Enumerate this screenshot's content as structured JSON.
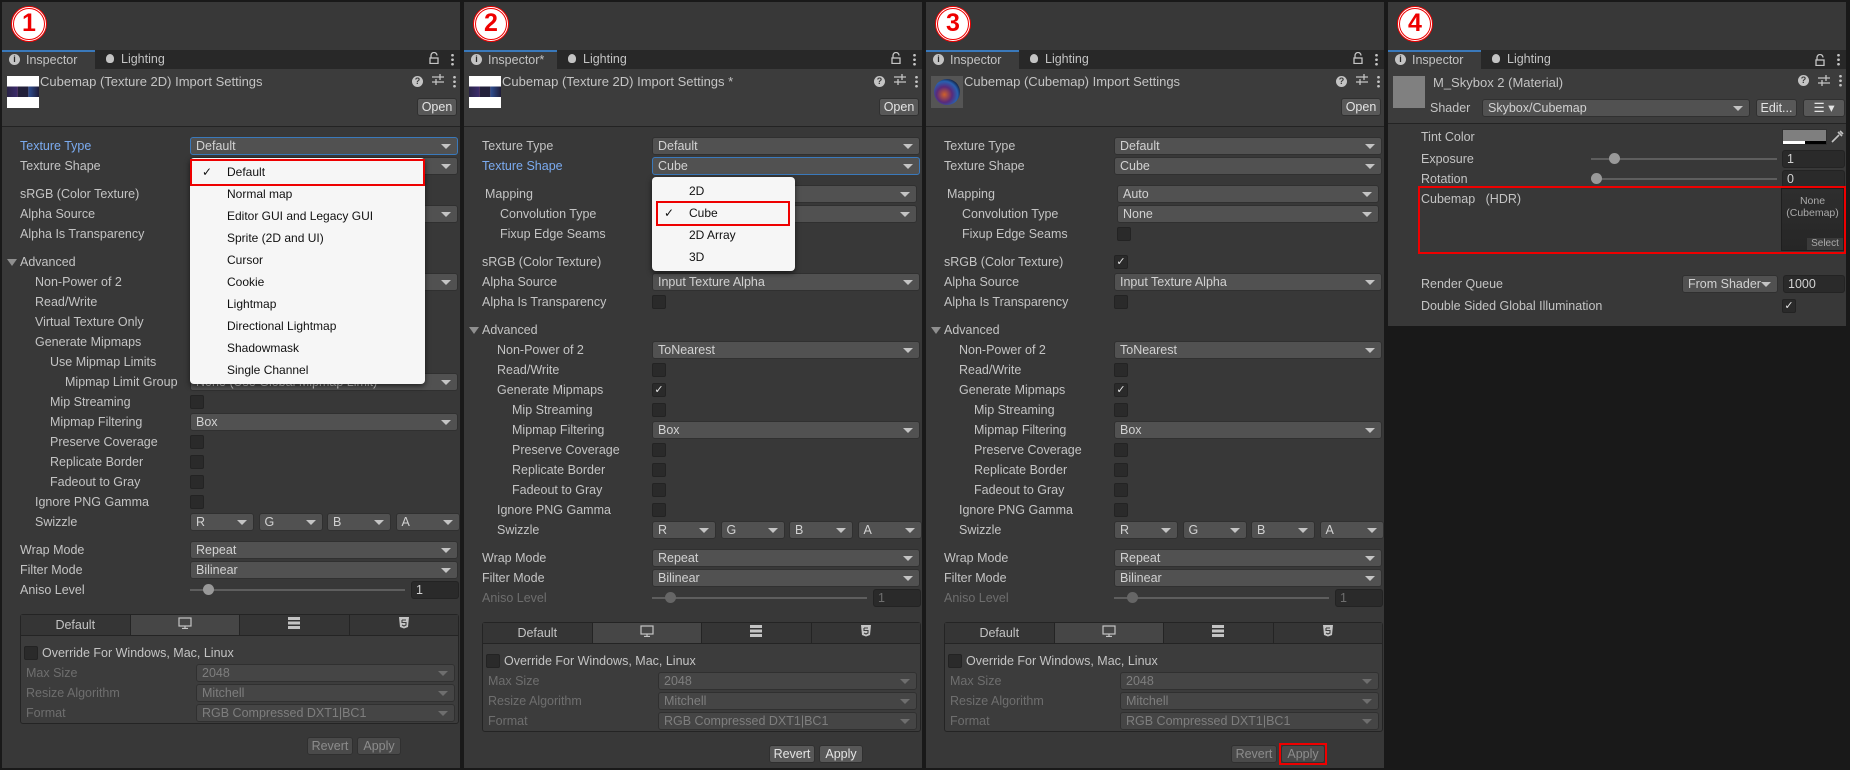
{
  "colors": {
    "accent": "#3a79bb",
    "highlight": "#e00000",
    "panel_bg": "#383838"
  },
  "panels": [
    {
      "badge": "1",
      "tabs": {
        "inspector": "Inspector",
        "lighting": "Lighting"
      },
      "title": "Cubemap (Texture 2D) Import Settings",
      "thumb": "cross",
      "open_label": "Open",
      "sections": [
        [
          {
            "label": "Texture Type",
            "type": "dropdown",
            "value": "Default",
            "focus": true
          },
          {
            "label": "Texture Shape",
            "type": "dropdown"
          }
        ],
        [
          {
            "label": "sRGB (Color Texture)",
            "type": "checkbox"
          },
          {
            "label": "Alpha Source",
            "type": "dropdown"
          },
          {
            "label": "Alpha Is Transparency",
            "type": "checkbox"
          }
        ],
        [
          {
            "label": "Advanced",
            "type": "foldout"
          },
          {
            "label": "Non-Power of 2",
            "indent": 1,
            "type": "dropdown"
          },
          {
            "label": "Read/Write",
            "indent": 1,
            "type": "checkbox"
          },
          {
            "label": "Virtual Texture Only",
            "indent": 1,
            "type": "checkbox"
          },
          {
            "label": "Generate Mipmaps",
            "indent": 1,
            "type": "checkbox"
          },
          {
            "label": "Use Mipmap Limits",
            "indent": 2,
            "type": "checkbox"
          },
          {
            "label": "Mipmap Limit Group",
            "indent": 3,
            "type": "dropdown",
            "value": "None (Use Global Mipmap Limit)"
          },
          {
            "label": "Mip Streaming",
            "indent": 2,
            "type": "checkbox"
          },
          {
            "label": "Mipmap Filtering",
            "indent": 2,
            "type": "dropdown",
            "value": "Box"
          },
          {
            "label": "Preserve Coverage",
            "indent": 2,
            "type": "checkbox"
          },
          {
            "label": "Replicate Border",
            "indent": 2,
            "type": "checkbox"
          },
          {
            "label": "Fadeout to Gray",
            "indent": 2,
            "type": "checkbox"
          },
          {
            "label": "Ignore PNG Gamma",
            "indent": 1,
            "type": "checkbox"
          },
          {
            "label": "Swizzle",
            "indent": 1,
            "type": "swizzle",
            "values": [
              "R",
              "G",
              "B",
              "A"
            ]
          }
        ],
        [
          {
            "label": "Wrap Mode",
            "type": "dropdown",
            "value": "Repeat"
          },
          {
            "label": "Filter Mode",
            "type": "dropdown",
            "value": "Bilinear"
          },
          {
            "label": "Aniso Level",
            "type": "slider",
            "value": 1
          }
        ]
      ],
      "platform": {
        "tabs": [
          "Default",
          "monitor-icon",
          "server-icon",
          "html5-icon"
        ],
        "selected": 1,
        "override": "Override For Windows, Mac, Linux",
        "rows": [
          {
            "label": "Max Size",
            "value": "2048"
          },
          {
            "label": "Resize Algorithm",
            "value": "Mitchell"
          },
          {
            "label": "Format",
            "value": "RGB Compressed DXT1|BC1"
          }
        ]
      },
      "revert": "Revert",
      "apply": "Apply",
      "buttons_enabled": false,
      "apply_highlight": false,
      "popup": {
        "items": [
          "Default",
          "Normal map",
          "Editor GUI and Legacy GUI",
          "Sprite (2D and UI)",
          "Cursor",
          "Cookie",
          "Lightmap",
          "Directional Lightmap",
          "Shadowmask",
          "Single Channel"
        ],
        "selected": 0
      }
    },
    {
      "badge": "2",
      "tabs": {
        "inspector": "Inspector*",
        "lighting": "Lighting"
      },
      "title": "Cubemap (Texture 2D) Import Settings *",
      "thumb": "cross",
      "open_label": "Open",
      "sections": [
        [
          {
            "label": "Texture Type",
            "type": "dropdown",
            "value": "Default"
          },
          {
            "label": "Texture Shape",
            "type": "dropdown",
            "value": "Cube",
            "focus": true
          }
        ],
        [
          {
            "label": "Mapping",
            "type": "dropdown",
            "inset": true
          },
          {
            "label": "Convolution Type",
            "indent": 1,
            "type": "dropdown",
            "inset": true
          },
          {
            "label": "Fixup Edge Seams",
            "indent": 1,
            "type": "checkbox",
            "inset": true
          }
        ],
        [
          {
            "label": "sRGB (Color Texture)",
            "type": "checkbox"
          },
          {
            "label": "Alpha Source",
            "type": "dropdown",
            "value": "Input Texture Alpha"
          },
          {
            "label": "Alpha Is Transparency",
            "type": "checkbox"
          }
        ],
        [
          {
            "label": "Advanced",
            "type": "foldout"
          },
          {
            "label": "Non-Power of 2",
            "indent": 1,
            "type": "dropdown",
            "value": "ToNearest"
          },
          {
            "label": "Read/Write",
            "indent": 1,
            "type": "checkbox"
          },
          {
            "label": "Generate Mipmaps",
            "indent": 1,
            "type": "checkbox",
            "checked": true
          },
          {
            "label": "Mip Streaming",
            "indent": 2,
            "type": "checkbox"
          },
          {
            "label": "Mipmap Filtering",
            "indent": 2,
            "type": "dropdown",
            "value": "Box"
          },
          {
            "label": "Preserve Coverage",
            "indent": 2,
            "type": "checkbox"
          },
          {
            "label": "Replicate Border",
            "indent": 2,
            "type": "checkbox"
          },
          {
            "label": "Fadeout to Gray",
            "indent": 2,
            "type": "checkbox"
          },
          {
            "label": "Ignore PNG Gamma",
            "indent": 1,
            "type": "checkbox"
          },
          {
            "label": "Swizzle",
            "indent": 1,
            "type": "swizzle",
            "values": [
              "R",
              "G",
              "B",
              "A"
            ]
          }
        ],
        [
          {
            "label": "Wrap Mode",
            "type": "dropdown",
            "value": "Repeat"
          },
          {
            "label": "Filter Mode",
            "type": "dropdown",
            "value": "Bilinear"
          },
          {
            "label": "Aniso Level",
            "type": "slider",
            "value": 1,
            "disabled": true
          }
        ]
      ],
      "platform": {
        "tabs": [
          "Default",
          "monitor-icon",
          "server-icon",
          "html5-icon"
        ],
        "selected": 1,
        "override": "Override For Windows, Mac, Linux",
        "rows": [
          {
            "label": "Max Size",
            "value": "2048"
          },
          {
            "label": "Resize Algorithm",
            "value": "Mitchell"
          },
          {
            "label": "Format",
            "value": "RGB Compressed DXT1|BC1"
          }
        ]
      },
      "revert": "Revert",
      "apply": "Apply",
      "buttons_enabled": true,
      "apply_highlight": false,
      "popup": {
        "items": [
          "2D",
          "Cube",
          "2D Array",
          "3D"
        ],
        "selected": 1
      }
    },
    {
      "badge": "3",
      "tabs": {
        "inspector": "Inspector",
        "lighting": "Lighting"
      },
      "title": "Cubemap (Cubemap) Import Settings",
      "thumb": "sphere",
      "open_label": "Open",
      "sections": [
        [
          {
            "label": "Texture Type",
            "type": "dropdown",
            "value": "Default"
          },
          {
            "label": "Texture Shape",
            "type": "dropdown",
            "value": "Cube"
          }
        ],
        [
          {
            "label": "Mapping",
            "type": "dropdown",
            "value": "Auto",
            "inset": true
          },
          {
            "label": "Convolution Type",
            "indent": 1,
            "type": "dropdown",
            "value": "None",
            "inset": true
          },
          {
            "label": "Fixup Edge Seams",
            "indent": 1,
            "type": "checkbox",
            "inset": true
          }
        ],
        [
          {
            "label": "sRGB (Color Texture)",
            "type": "checkbox",
            "checked": true
          },
          {
            "label": "Alpha Source",
            "type": "dropdown",
            "value": "Input Texture Alpha"
          },
          {
            "label": "Alpha Is Transparency",
            "type": "checkbox"
          }
        ],
        [
          {
            "label": "Advanced",
            "type": "foldout"
          },
          {
            "label": "Non-Power of 2",
            "indent": 1,
            "type": "dropdown",
            "value": "ToNearest"
          },
          {
            "label": "Read/Write",
            "indent": 1,
            "type": "checkbox"
          },
          {
            "label": "Generate Mipmaps",
            "indent": 1,
            "type": "checkbox",
            "checked": true
          },
          {
            "label": "Mip Streaming",
            "indent": 2,
            "type": "checkbox"
          },
          {
            "label": "Mipmap Filtering",
            "indent": 2,
            "type": "dropdown",
            "value": "Box"
          },
          {
            "label": "Preserve Coverage",
            "indent": 2,
            "type": "checkbox"
          },
          {
            "label": "Replicate Border",
            "indent": 2,
            "type": "checkbox"
          },
          {
            "label": "Fadeout to Gray",
            "indent": 2,
            "type": "checkbox"
          },
          {
            "label": "Ignore PNG Gamma",
            "indent": 1,
            "type": "checkbox"
          },
          {
            "label": "Swizzle",
            "indent": 1,
            "type": "swizzle",
            "values": [
              "R",
              "G",
              "B",
              "A"
            ]
          }
        ],
        [
          {
            "label": "Wrap Mode",
            "type": "dropdown",
            "value": "Repeat"
          },
          {
            "label": "Filter Mode",
            "type": "dropdown",
            "value": "Bilinear"
          },
          {
            "label": "Aniso Level",
            "type": "slider",
            "value": 1,
            "disabled": true
          }
        ]
      ],
      "platform": {
        "tabs": [
          "Default",
          "monitor-icon",
          "server-icon",
          "html5-icon"
        ],
        "selected": 1,
        "override": "Override For Windows, Mac, Linux",
        "rows": [
          {
            "label": "Max Size",
            "value": "2048"
          },
          {
            "label": "Resize Algorithm",
            "value": "Mitchell"
          },
          {
            "label": "Format",
            "value": "RGB Compressed DXT1|BC1"
          }
        ]
      },
      "revert": "Revert",
      "apply": "Apply",
      "buttons_enabled": false,
      "apply_highlight": true
    },
    {
      "badge": "4",
      "tabs": {
        "inspector": "Inspector",
        "lighting": "Lighting"
      },
      "title": "M_Skybox 2 (Material)",
      "shader_label": "Shader",
      "shader_value": "Skybox/Cubemap",
      "edit_label": "Edit...",
      "tint_label": "Tint Color",
      "exposure": {
        "label": "Exposure",
        "value": 1,
        "range": [
          0,
          8
        ]
      },
      "rotation": {
        "label": "Rotation",
        "value": 0,
        "range": [
          0,
          360
        ]
      },
      "cubemap": {
        "label": "Cubemap",
        "suffix": "(HDR)",
        "value_line1": "None",
        "value_line2": "(Cubemap)",
        "select": "Select"
      },
      "render_queue": {
        "label": "Render Queue",
        "mode": "From Shader",
        "value": "1000"
      },
      "double_sided": {
        "label": "Double Sided Global Illumination",
        "checked": true
      }
    }
  ]
}
